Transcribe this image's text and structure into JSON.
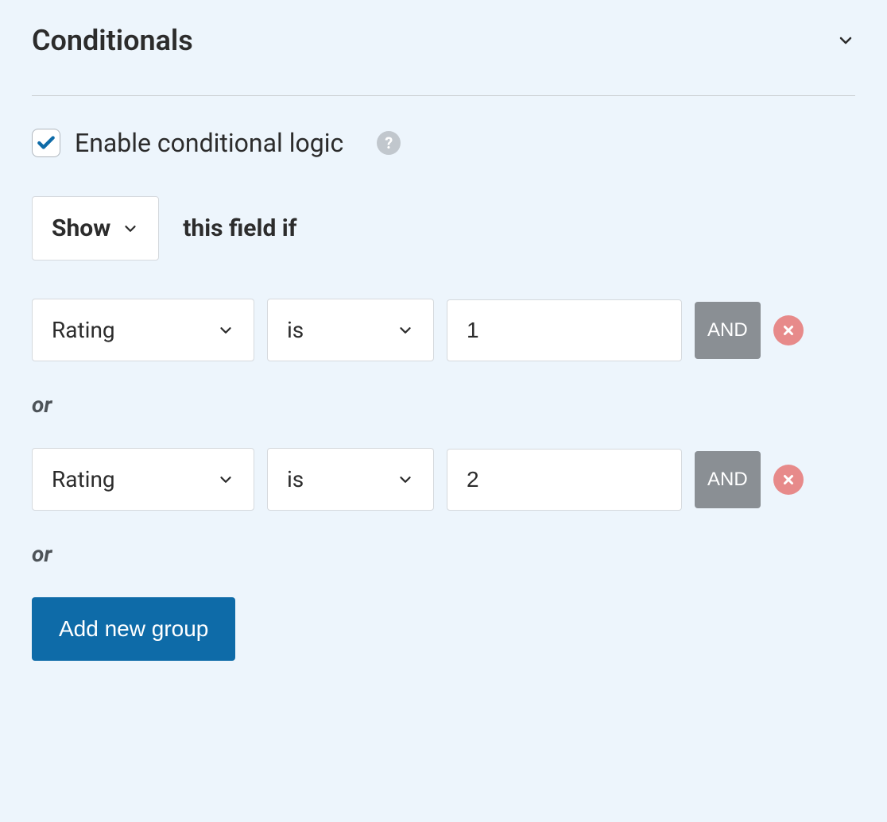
{
  "panel": {
    "title": "Conditionals"
  },
  "enable": {
    "checked": true,
    "label": "Enable conditional logic"
  },
  "action": {
    "select_value": "Show",
    "postfix": "this field if"
  },
  "rules": [
    {
      "field": "Rating",
      "operator": "is",
      "value": "1",
      "and_label": "AND"
    },
    {
      "field": "Rating",
      "operator": "is",
      "value": "2",
      "and_label": "AND"
    }
  ],
  "or_label": "or",
  "add_group_label": "Add new group"
}
